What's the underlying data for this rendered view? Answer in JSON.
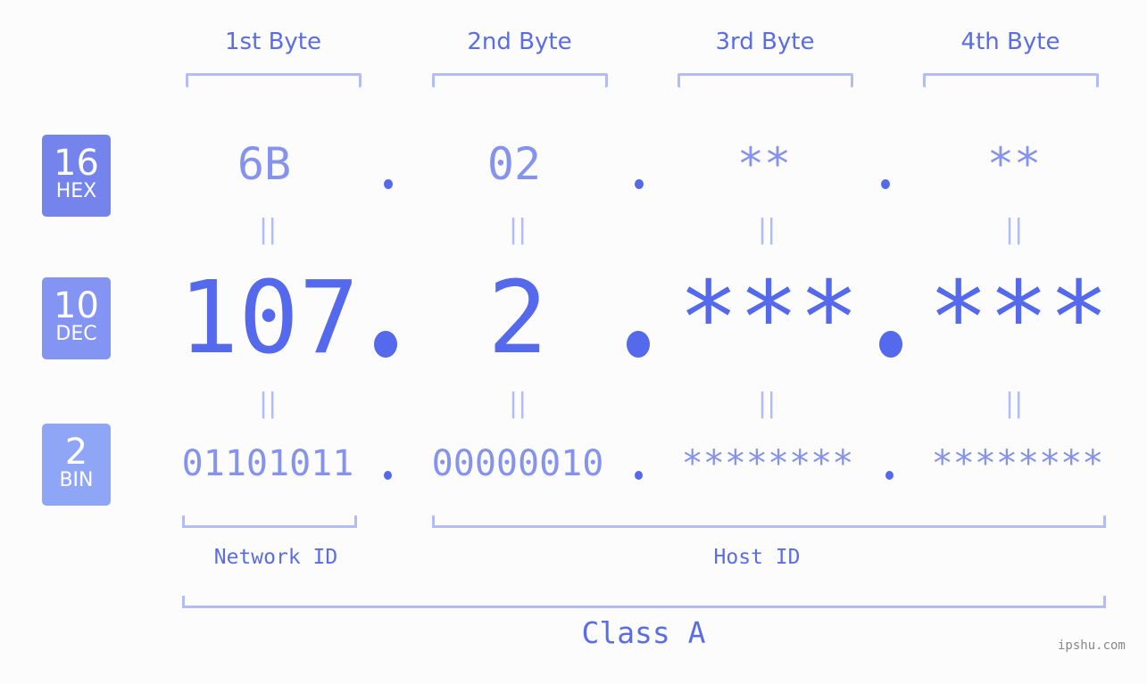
{
  "bytes": [
    {
      "header": "1st Byte",
      "hex": "6B",
      "dec": "107",
      "bin": "01101011"
    },
    {
      "header": "2nd Byte",
      "hex": "02",
      "dec": "2",
      "bin": "00000010"
    },
    {
      "header": "3rd Byte",
      "hex": "**",
      "dec": "***",
      "bin": "********"
    },
    {
      "header": "4th Byte",
      "hex": "**",
      "dec": "***",
      "bin": "********"
    }
  ],
  "badges": {
    "hex": {
      "number": "16",
      "label": "HEX",
      "color": "#7584ec"
    },
    "dec": {
      "number": "10",
      "label": "DEC",
      "color": "#8494f2"
    },
    "bin": {
      "number": "2",
      "label": "BIN",
      "color": "#8fa6f7"
    }
  },
  "equals_symbol": "||",
  "network_id_label": "Network ID",
  "host_id_label": "Host ID",
  "class_label": "Class A",
  "watermark": "ipshu.com",
  "colors": {
    "accent": "#5469ec",
    "light_value": "#8593ee",
    "bracket": "#b3bcf5",
    "background": "#fbfcfb"
  }
}
